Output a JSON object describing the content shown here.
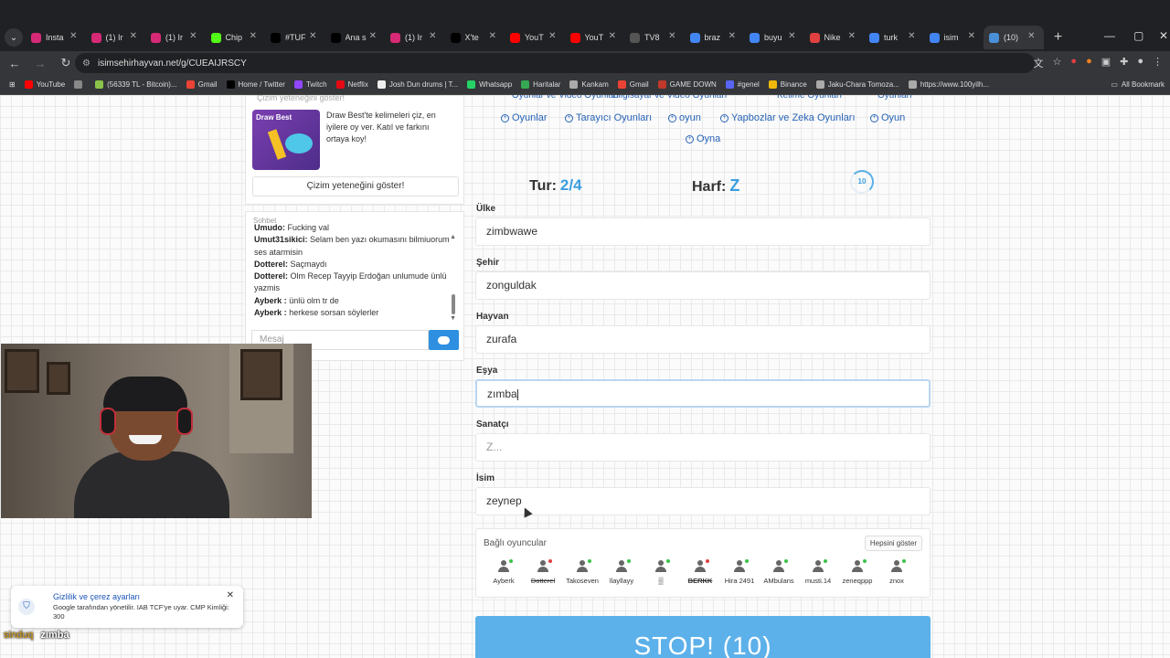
{
  "browser": {
    "tabs": [
      {
        "title": "Insta",
        "color": "#d62976"
      },
      {
        "title": "(1) Ir",
        "color": "#d62976"
      },
      {
        "title": "(1) Ir",
        "color": "#d62976"
      },
      {
        "title": "Chip",
        "color": "#53fc18"
      },
      {
        "title": "#TUF",
        "color": "#000000"
      },
      {
        "title": "Ana s",
        "color": "#000000"
      },
      {
        "title": "(1) Ir",
        "color": "#d62976"
      },
      {
        "title": "X'te",
        "color": "#000000"
      },
      {
        "title": "YouT",
        "color": "#ff0000"
      },
      {
        "title": "YouT",
        "color": "#ff0000"
      },
      {
        "title": "TV8",
        "color": "#555555"
      },
      {
        "title": "braz",
        "color": "#4285f4"
      },
      {
        "title": "buyu",
        "color": "#4285f4"
      },
      {
        "title": "Nike",
        "color": "#e04040"
      },
      {
        "title": "turk",
        "color": "#4285f4"
      },
      {
        "title": "isim",
        "color": "#4285f4"
      },
      {
        "title": "(10)",
        "color": "#4a8fd8"
      }
    ],
    "url": "isimsehirhayvan.net/g/CUEAIJRSCY",
    "bookmarks": [
      {
        "label": "YouTube",
        "color": "#ff0000"
      },
      {
        "label": "",
        "color": "#888888"
      },
      {
        "label": "(56339 TL - Bitcoin)...",
        "color": "#8bc34a"
      },
      {
        "label": "Gmail",
        "color": "#ea4335"
      },
      {
        "label": "Home / Twitter",
        "color": "#000000"
      },
      {
        "label": "Twitch",
        "color": "#9146ff"
      },
      {
        "label": "Netflix",
        "color": "#e50914"
      },
      {
        "label": "Josh Dun drums | T...",
        "color": "#eeeeee"
      },
      {
        "label": "Whatsapp",
        "color": "#25d366"
      },
      {
        "label": "Haritalar",
        "color": "#34a853"
      },
      {
        "label": "Kankam",
        "color": "#aaaaaa"
      },
      {
        "label": "Gmail",
        "color": "#ea4335"
      },
      {
        "label": "GAME DOWN",
        "color": "#c0392b"
      },
      {
        "label": "#genel",
        "color": "#5865f2"
      },
      {
        "label": "Binance",
        "color": "#f0b90b"
      },
      {
        "label": "Jaku-Chara Tomoza...",
        "color": "#aaaaaa"
      },
      {
        "label": "https://www.100yilh...",
        "color": "#aaaaaa"
      }
    ],
    "all_bookmarks": "All Bookmark"
  },
  "draw_panel": {
    "top_label": "Çizim yeteneğini göster!",
    "promo_title": "Draw Best",
    "promo_text": "Draw Best'te kelimeleri çiz, en iyilere oy ver. Katıl ve farkını ortaya koy!",
    "button": "Çizim yeteneğini göster!"
  },
  "chat": {
    "title": "Sohbet",
    "messages": [
      {
        "user": "Umudo:",
        "text": " Fucking val"
      },
      {
        "user": "Umut31sikici:",
        "text": " Selam ben yazı okumasını bilmiuorum ses atarmisin"
      },
      {
        "user": "Dotterel:",
        "text": " Saçmaydı"
      },
      {
        "user": "Dotterel:",
        "text": " Olm Recep Tayyip Erdoğan unlumude ünlü yazmis"
      },
      {
        "user": "Ayberk :",
        "text": " ünlü olm tr de"
      },
      {
        "user": "Ayberk :",
        "text": " herkese sorsan söylerler"
      }
    ],
    "input_placeholder": "Mesaj"
  },
  "tags_cut": [
    "Oyunlar ve Video Oyunları",
    "Bilgisayar ve Video Oyunları",
    "Kelime Oyunları",
    "Oyunları"
  ],
  "tags": [
    "Oyunlar",
    "Tarayıcı Oyunları",
    "oyun",
    "Yapbozlar ve Zeka Oyunları",
    "Oyun",
    "Oyna"
  ],
  "game": {
    "round_label": "Tur:",
    "round_value": "2/4",
    "letter_label": "Harf:",
    "letter_value": "Z",
    "timer": "10"
  },
  "fields": [
    {
      "label": "Ülke",
      "value": "zimbwawe"
    },
    {
      "label": "Şehir",
      "value": "zonguldak"
    },
    {
      "label": "Hayvan",
      "value": "zurafa"
    },
    {
      "label": "Eşya",
      "value": "zımba"
    },
    {
      "label": "Sanatçı",
      "placeholder": "Z..."
    },
    {
      "label": "İsim",
      "value": "zeynep"
    }
  ],
  "players": {
    "title": "Bağlı oyuncular",
    "show_all": "Hepsini göster",
    "list": [
      {
        "name": "Ayberk",
        "status": "online"
      },
      {
        "name": "Dotterel",
        "status": "offline"
      },
      {
        "name": "Takoseven",
        "status": "online"
      },
      {
        "name": "llayllayy",
        "status": "online"
      },
      {
        "name": "▒",
        "status": "online"
      },
      {
        "name": "BERKK",
        "status": "offline"
      },
      {
        "name": "Hira 2491",
        "status": "online"
      },
      {
        "name": "AMbulans",
        "status": "online"
      },
      {
        "name": "musti.14",
        "status": "online"
      },
      {
        "name": "zeneqppp",
        "status": "online"
      },
      {
        "name": "znox",
        "status": "online"
      }
    ]
  },
  "stop_button": "STOP! (10)",
  "cookie": {
    "title": "Gizlilik ve çerez ayarları",
    "text": "Google tarafından yönetilir. IAB TCF'ye uyar. CMP Kimliği: 300"
  },
  "stream_caption": {
    "user": "sinduq",
    "text": "zımba"
  }
}
